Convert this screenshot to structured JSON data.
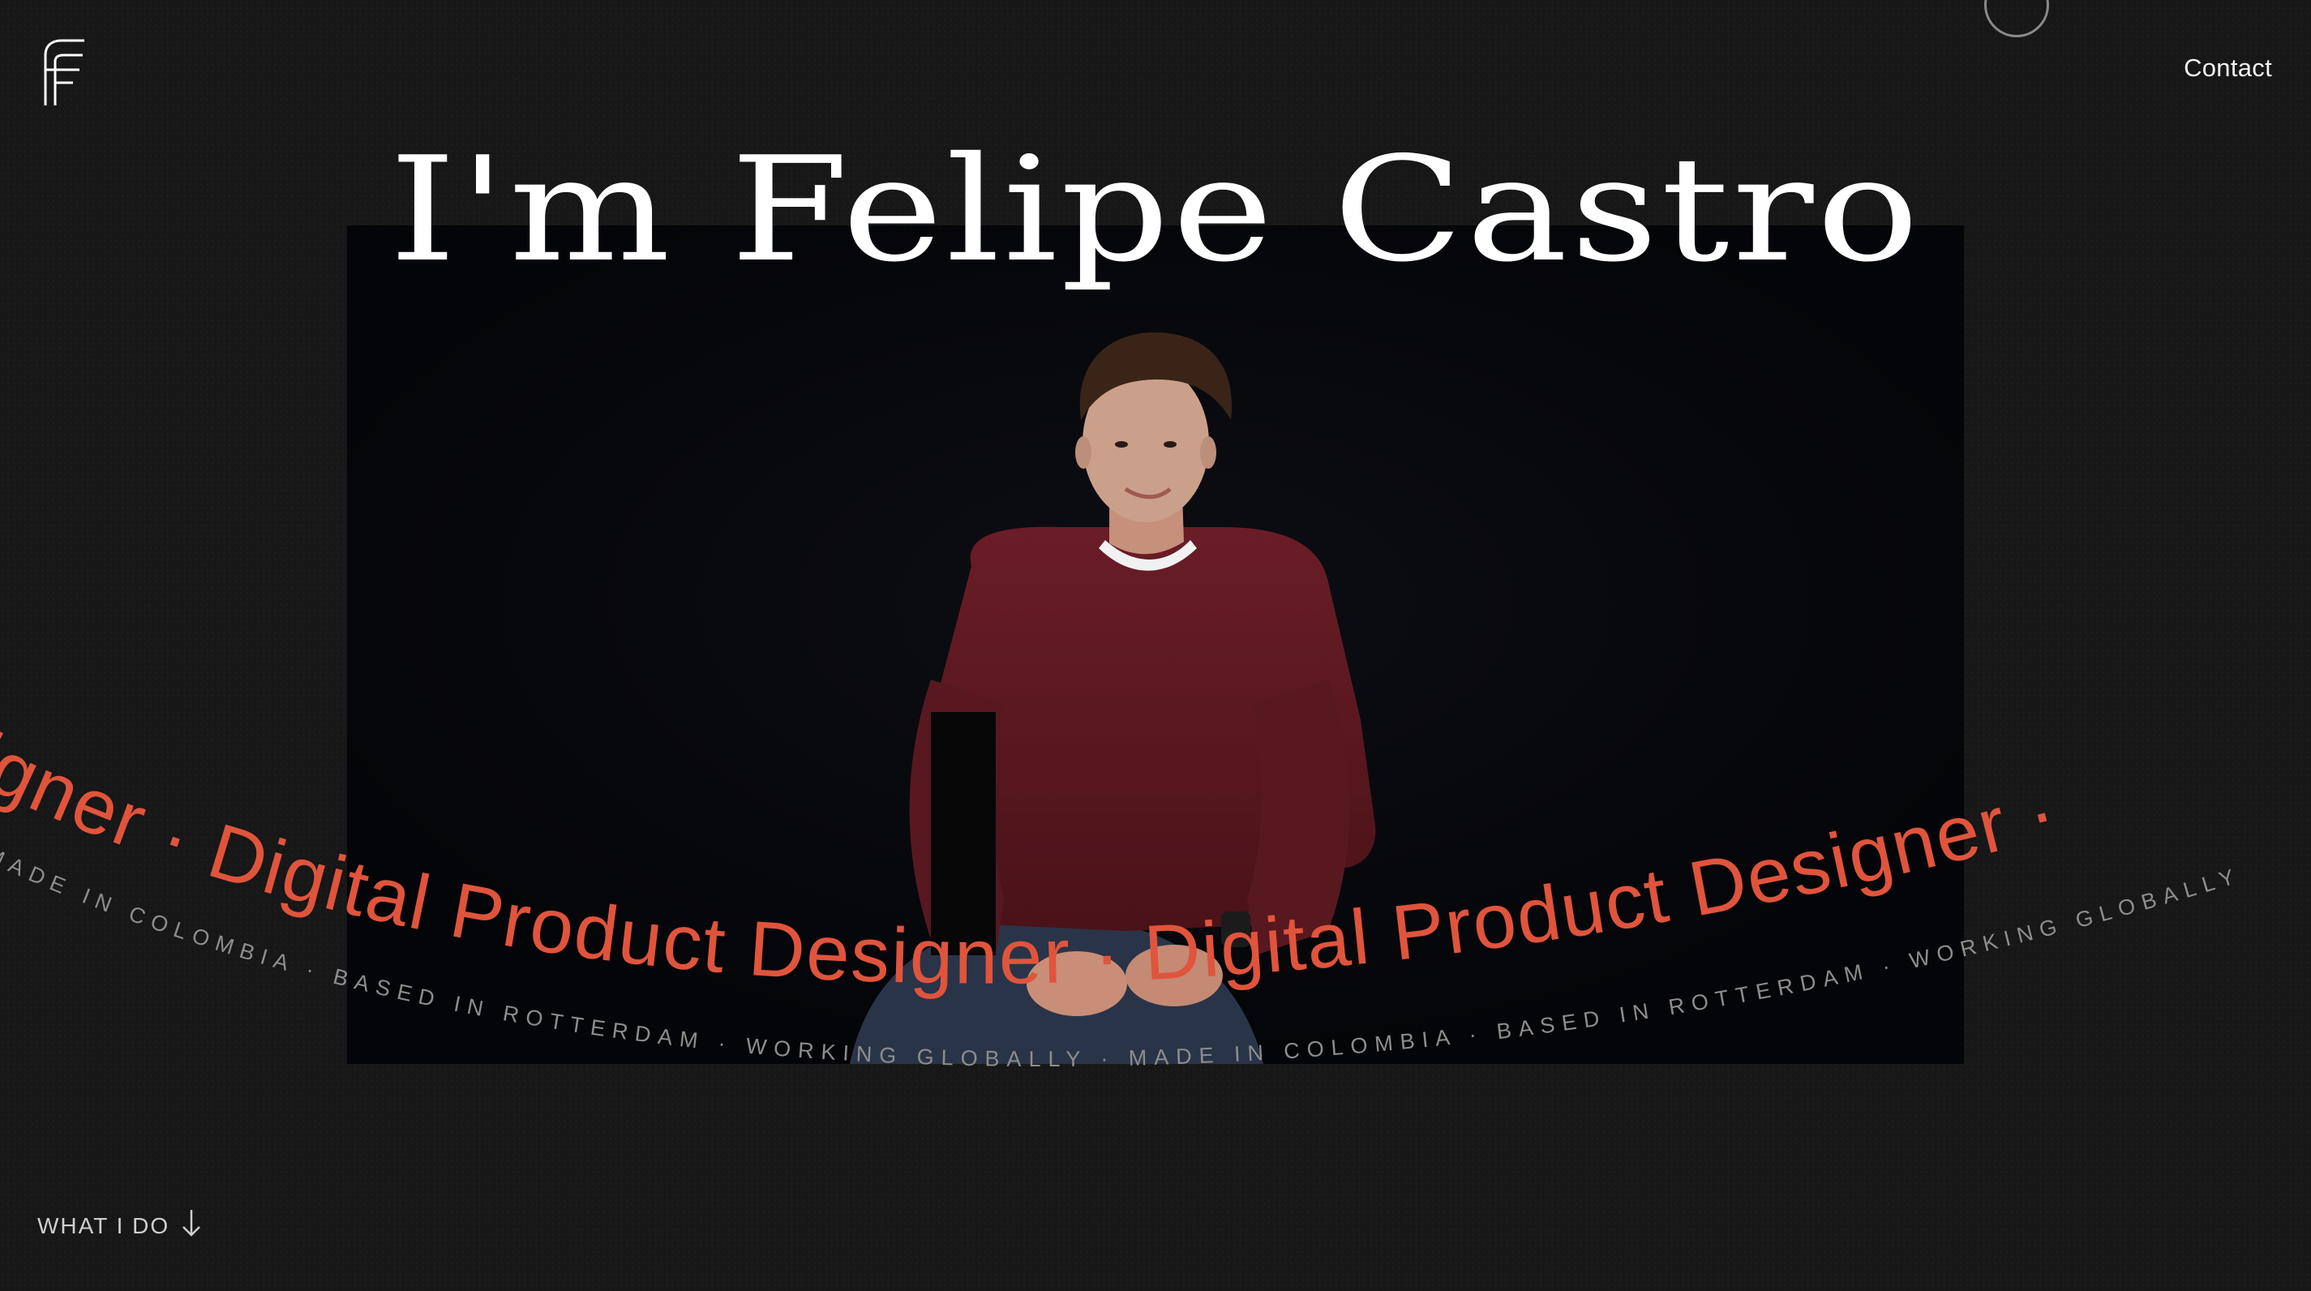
{
  "header": {
    "logo_icon": "felipe-castro-logo-icon",
    "contact_label": "Contact"
  },
  "hero": {
    "title": "I'm Felipe Castro",
    "photo_icon": "portrait-photo"
  },
  "marquee": {
    "role_text": "igner · Digital Product Designer · Digital Product Designer ·",
    "tagline_text": "MADE IN COLOMBIA · BASED IN ROTTERDAM · WORKING GLOBALLY · MADE IN COLOMBIA · BASED IN ROTTERDAM · WORKING GLOBALLY",
    "role_color": "#e0543c",
    "tagline_color": "#8d8d8d"
  },
  "footer": {
    "what_i_do_label": "WHAT I DO",
    "arrow_icon": "arrow-down-icon"
  }
}
